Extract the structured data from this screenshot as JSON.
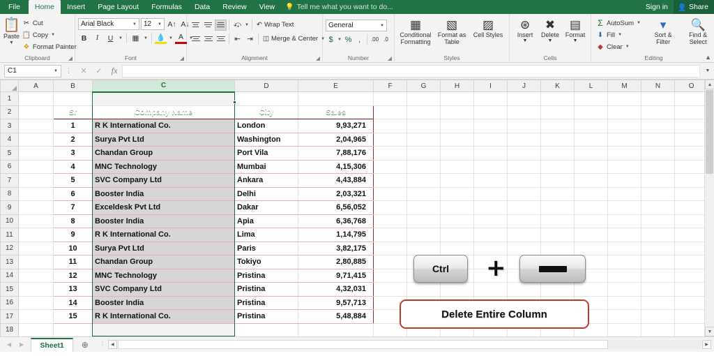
{
  "titlebar": {
    "tabs": [
      {
        "label": "File",
        "active": false
      },
      {
        "label": "Home",
        "active": true
      },
      {
        "label": "Insert",
        "active": false
      },
      {
        "label": "Page Layout",
        "active": false
      },
      {
        "label": "Formulas",
        "active": false
      },
      {
        "label": "Data",
        "active": false
      },
      {
        "label": "Review",
        "active": false
      },
      {
        "label": "View",
        "active": false
      }
    ],
    "tellme": "Tell me what you want to do...",
    "bulb_icon": "lightbulb-icon",
    "signin": "Sign in",
    "share": "Share",
    "share_icon": "person-share-icon",
    "accent_color": "#217346"
  },
  "ribbon": {
    "clipboard": {
      "title": "Clipboard",
      "paste": "Paste",
      "paste_icon": "clipboard-icon",
      "cut": "Cut",
      "cut_icon": "scissors-icon",
      "copy": "Copy",
      "copy_icon": "copy-icon",
      "format_painter": "Format Painter",
      "format_painter_icon": "paintbrush-icon"
    },
    "font": {
      "title": "Font",
      "font_name": "Arial Black",
      "font_size": "12",
      "grow_icon": "grow-font-icon",
      "shrink_icon": "shrink-font-icon",
      "bold": "B",
      "italic": "I",
      "underline": "U",
      "borders_icon": "borders-icon",
      "fill_icon": "fill-color-icon",
      "font_color_icon": "font-color-icon"
    },
    "alignment": {
      "title": "Alignment",
      "wrap_text": "Wrap Text",
      "wrap_icon": "wrap-text-icon",
      "merge_center": "Merge & Center",
      "merge_icon": "merge-cells-icon",
      "orientation_icon": "orientation-icon",
      "indent_dec_icon": "decrease-indent-icon",
      "indent_inc_icon": "increase-indent-icon"
    },
    "number": {
      "title": "Number",
      "format": "General",
      "currency_icon": "currency-icon",
      "percent_icon": "percent-icon",
      "comma_icon": "comma-style-icon",
      "inc_dec_icon": "increase-decimal-icon",
      "dec_dec_icon": "decrease-decimal-icon"
    },
    "styles": {
      "title": "Styles",
      "conditional": "Conditional Formatting",
      "conditional_icon": "conditional-formatting-icon",
      "format_table": "Format as Table",
      "format_table_icon": "format-as-table-icon",
      "cell_styles": "Cell Styles",
      "cell_styles_icon": "cell-styles-icon"
    },
    "cells": {
      "title": "Cells",
      "insert": "Insert",
      "insert_icon": "insert-cells-icon",
      "delete": "Delete",
      "delete_icon": "delete-cells-icon",
      "format": "Format",
      "format_icon": "format-cells-icon"
    },
    "editing": {
      "title": "Editing",
      "autosum": "AutoSum",
      "autosum_icon": "sigma-icon",
      "fill": "Fill",
      "fill_icon": "fill-down-icon",
      "clear": "Clear",
      "clear_icon": "eraser-icon",
      "sort_filter": "Sort & Filter",
      "sort_filter_icon": "sort-filter-icon",
      "find_select": "Find & Select",
      "find_select_icon": "magnifier-icon"
    },
    "collapse_icon": "chevron-up-icon"
  },
  "formula_bar": {
    "name_box": "C1",
    "cancel_icon": "cancel-icon",
    "confirm_icon": "check-icon",
    "function_icon": "insert-function-icon",
    "formula_value": "",
    "expand_icon": "expand-formula-bar-icon"
  },
  "grid": {
    "columns": [
      "A",
      "B",
      "C",
      "D",
      "E",
      "F",
      "G",
      "H",
      "I",
      "J",
      "K",
      "L",
      "M",
      "N",
      "O"
    ],
    "selected_column": "C",
    "rows": [
      1,
      2,
      3,
      4,
      5,
      6,
      7,
      8,
      9,
      10,
      11,
      12,
      13,
      14,
      15,
      16,
      17,
      18
    ],
    "table": {
      "header_row": 2,
      "headers": [
        "Sr",
        "Company Name",
        "City",
        "Sales"
      ],
      "rows": [
        {
          "sr": "1",
          "company": "R K International Co.",
          "city": "London",
          "sales": "9,93,271"
        },
        {
          "sr": "2",
          "company": "Surya Pvt Ltd",
          "city": "Washington",
          "sales": "2,04,965"
        },
        {
          "sr": "3",
          "company": "Chandan Group",
          "city": "Port Vila",
          "sales": "7,88,176"
        },
        {
          "sr": "4",
          "company": "MNC Technology",
          "city": "Mumbai",
          "sales": "4,15,306"
        },
        {
          "sr": "5",
          "company": "SVC Company Ltd",
          "city": "Ankara",
          "sales": "4,43,884"
        },
        {
          "sr": "6",
          "company": "Booster India",
          "city": "Delhi",
          "sales": "2,03,321"
        },
        {
          "sr": "7",
          "company": "Exceldesk Pvt Ltd",
          "city": "Dakar",
          "sales": "6,56,052"
        },
        {
          "sr": "8",
          "company": "Booster India",
          "city": "Apia",
          "sales": "6,36,768"
        },
        {
          "sr": "9",
          "company": "R K International Co.",
          "city": "Lima",
          "sales": "1,14,795"
        },
        {
          "sr": "10",
          "company": "Surya Pvt Ltd",
          "city": "Paris",
          "sales": "3,82,175"
        },
        {
          "sr": "11",
          "company": "Chandan Group",
          "city": "Tokiyo",
          "sales": "2,80,885"
        },
        {
          "sr": "12",
          "company": "MNC Technology",
          "city": "Pristina",
          "sales": "9,71,415"
        },
        {
          "sr": "13",
          "company": "SVC Company Ltd",
          "city": "Pristina",
          "sales": "4,32,031"
        },
        {
          "sr": "14",
          "company": "Booster India",
          "city": "Pristina",
          "sales": "9,57,713"
        },
        {
          "sr": "15",
          "company": "R K International Co.",
          "city": "Pristina",
          "sales": "5,48,884"
        }
      ],
      "header_bg": "#7a3d16",
      "border_color": "#9c2b2b"
    }
  },
  "annotation": {
    "key1": "Ctrl",
    "plus": "+",
    "key2_icon": "minus-key-icon",
    "callout": "Delete Entire Column",
    "callout_border": "#c0392b"
  },
  "sheetbar": {
    "prev_icon": "prev-sheet-icon",
    "next_icon": "next-sheet-icon",
    "sheet_name": "Sheet1",
    "add_sheet_icon": "add-sheet-icon",
    "scroll_left_icon": "scroll-left-icon",
    "scroll_right_icon": "scroll-right-icon"
  }
}
